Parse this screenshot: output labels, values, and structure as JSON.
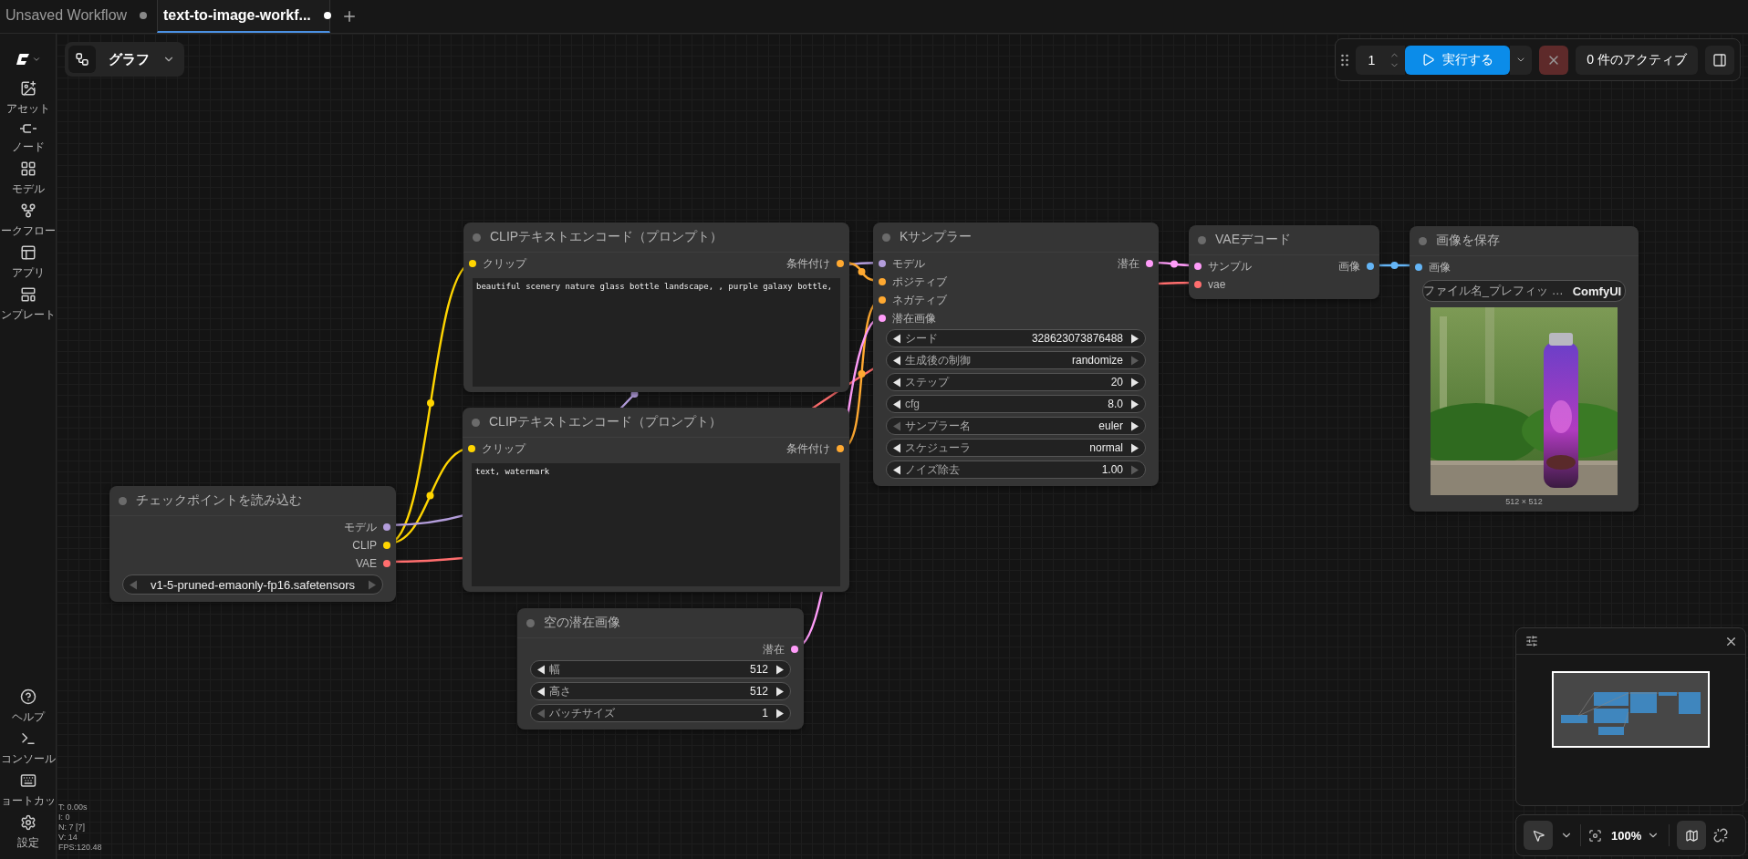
{
  "tabs": [
    {
      "label": "Unsaved Workflow",
      "selected": false
    },
    {
      "label": "text-to-image-workf...",
      "selected": true
    }
  ],
  "sidebar": {
    "top": [
      {
        "label": "アセット"
      },
      {
        "label": "ノード"
      },
      {
        "label": "モデル"
      },
      {
        "label": "ークフロー"
      },
      {
        "label": "アプリ"
      },
      {
        "label": "ンプレート"
      }
    ],
    "bottom": [
      {
        "label": "ヘルプ"
      },
      {
        "label": "コンソール"
      },
      {
        "label": "ョートカッ"
      },
      {
        "label": "設定"
      }
    ]
  },
  "graph_menu": {
    "label": "グラフ"
  },
  "run_toolbar": {
    "count": "1",
    "run_label": "実行する",
    "active_label": "0 件のアクティブ"
  },
  "nodes": [
    {
      "title": "CLIPテキストエンコード（プロンプト）",
      "inputs": [
        {
          "label": "クリップ",
          "color": "#ffd500"
        }
      ],
      "outputs": [
        {
          "label": "条件付け",
          "color": "#ffa931"
        }
      ],
      "widgets": [
        {
          "kind": "prompt",
          "value": "beautiful scenery nature glass bottle landscape, , purple galaxy bottle,"
        }
      ]
    },
    {
      "title": "CLIPテキストエンコード（プロンプト）",
      "inputs": [
        {
          "label": "クリップ",
          "color": "#ffd500"
        }
      ],
      "outputs": [
        {
          "label": "条件付け",
          "color": "#ffa931"
        }
      ],
      "widgets": [
        {
          "kind": "prompt",
          "value": "text, watermark"
        }
      ]
    },
    {
      "title": "Kサンプラー",
      "inputs": [
        {
          "label": "モデル",
          "color": "#b39ddb"
        },
        {
          "label": "ポジティブ",
          "color": "#ffa931"
        },
        {
          "label": "ネガティブ",
          "color": "#ffa931"
        },
        {
          "label": "潜在画像",
          "color": "#ff9cf9"
        }
      ],
      "outputs": [
        {
          "label": "潜在",
          "color": "#ff9cf9"
        }
      ],
      "widgets": [
        {
          "kind": "stepper",
          "label": "シード",
          "value": "328623073876488",
          "prev_disabled": false,
          "next_disabled": false
        },
        {
          "kind": "stepper",
          "label": "生成後の制御",
          "value": "randomize",
          "prev_disabled": false,
          "next_disabled": true
        },
        {
          "kind": "stepper",
          "label": "ステップ",
          "value": "20",
          "prev_disabled": false,
          "next_disabled": false
        },
        {
          "kind": "stepper",
          "label": "cfg",
          "value": "8.0",
          "prev_disabled": false,
          "next_disabled": false
        },
        {
          "kind": "stepper",
          "label": "サンプラー名",
          "value": "euler",
          "prev_disabled": true,
          "next_disabled": false
        },
        {
          "kind": "stepper",
          "label": "スケジューラ",
          "value": "normal",
          "prev_disabled": false,
          "next_disabled": false
        },
        {
          "kind": "stepper",
          "label": "ノイズ除去",
          "value": "1.00",
          "prev_disabled": false,
          "next_disabled": true
        }
      ]
    },
    {
      "title": "VAEデコード",
      "inputs": [
        {
          "label": "サンプル",
          "color": "#ff9cf9"
        },
        {
          "label": "vae",
          "color": "#ff6e6e"
        }
      ],
      "outputs": [
        {
          "label": "画像",
          "color": "#64b5f6"
        }
      ]
    },
    {
      "title": "画像を保存",
      "inputs": [
        {
          "label": "画像",
          "color": "#64b5f6"
        }
      ],
      "widgets": [
        {
          "kind": "text",
          "label": "ファイル名_プレフィッ …",
          "value": "ComfyUI"
        },
        {
          "kind": "preview",
          "caption": "512 × 512"
        }
      ]
    },
    {
      "title": "チェックポイントを読み込む",
      "outputs": [
        {
          "label": "モデル",
          "color": "#b39ddb"
        },
        {
          "label": "CLIP",
          "color": "#ffd500"
        },
        {
          "label": "VAE",
          "color": "#ff6e6e"
        }
      ],
      "widgets": [
        {
          "kind": "select",
          "value": "v1-5-pruned-emaonly-fp16.safetensors",
          "prev_disabled": true,
          "next_disabled": true
        }
      ]
    },
    {
      "title": "空の潜在画像",
      "outputs": [
        {
          "label": "潜在",
          "color": "#ff9cf9"
        }
      ],
      "widgets": [
        {
          "kind": "stepper",
          "label": "幅",
          "value": "512",
          "prev_disabled": false,
          "next_disabled": false
        },
        {
          "kind": "stepper",
          "label": "高さ",
          "value": "512",
          "prev_disabled": false,
          "next_disabled": false
        },
        {
          "kind": "stepper",
          "label": "バッチサイズ",
          "value": "1",
          "prev_disabled": true,
          "next_disabled": false
        }
      ]
    }
  ],
  "stats": [
    "T: 0.00s",
    "I: 0",
    "N: 7 [7]",
    "V: 14",
    "FPS:120.48"
  ],
  "canvas_toolbar": {
    "pointer_selected": true,
    "zoom": "100%",
    "minimap_on": true
  }
}
